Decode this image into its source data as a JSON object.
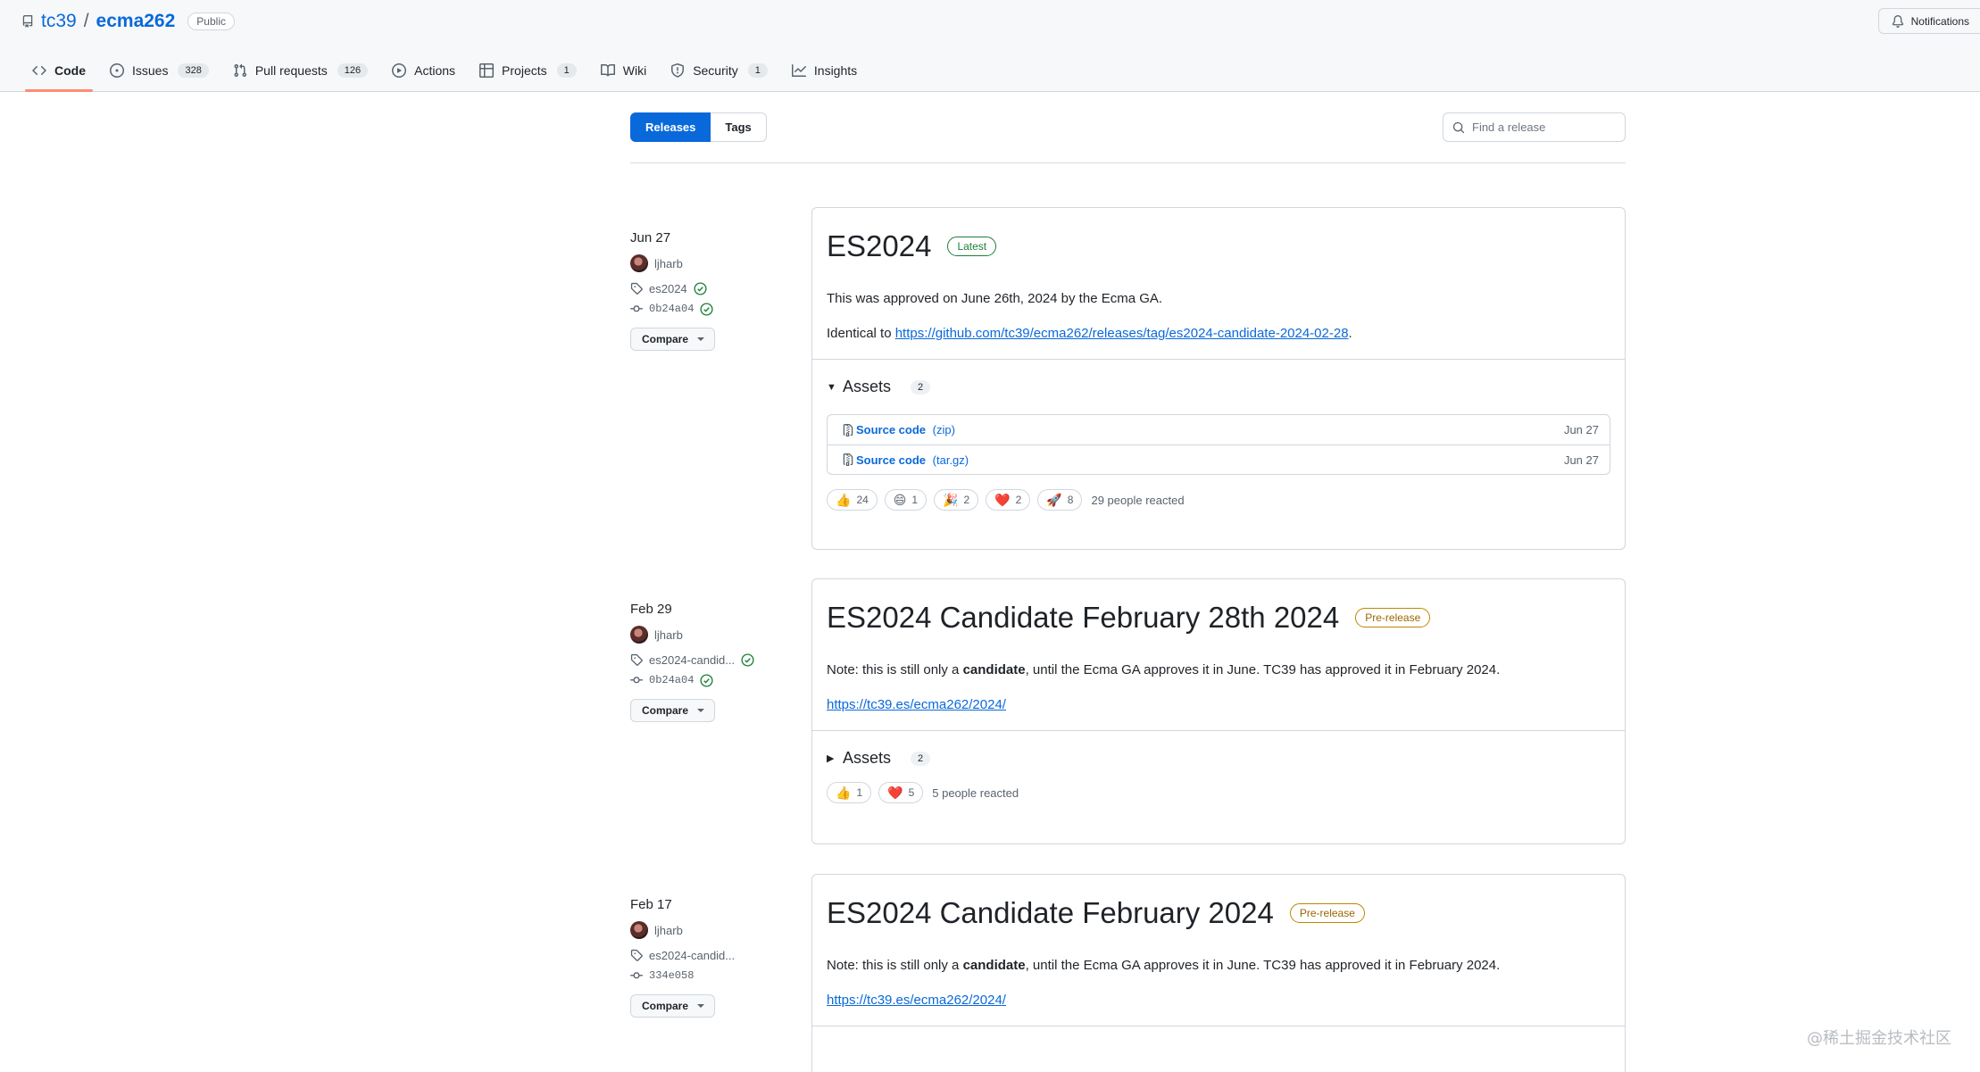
{
  "repo": {
    "owner": "tc39",
    "separator": "/",
    "name": "ecma262",
    "visibility": "Public"
  },
  "notifications_label": "Notifications",
  "nav": [
    {
      "label": "Code",
      "icon": "code-icon",
      "count": ""
    },
    {
      "label": "Issues",
      "icon": "issue-icon",
      "count": "328"
    },
    {
      "label": "Pull requests",
      "icon": "pull-request-icon",
      "count": "126"
    },
    {
      "label": "Actions",
      "icon": "play-icon",
      "count": ""
    },
    {
      "label": "Projects",
      "icon": "table-icon",
      "count": "1"
    },
    {
      "label": "Wiki",
      "icon": "book-icon",
      "count": ""
    },
    {
      "label": "Security",
      "icon": "shield-icon",
      "count": "1"
    },
    {
      "label": "Insights",
      "icon": "graph-icon",
      "count": ""
    }
  ],
  "subnav": {
    "releases": "Releases",
    "tags": "Tags"
  },
  "search": {
    "placeholder": "Find a release"
  },
  "releases": [
    {
      "date": "Jun 27",
      "author": "ljharb",
      "tag": "es2024",
      "commit": "0b24a04",
      "compare": "Compare",
      "title": "ES2024",
      "label": "Latest",
      "p1": "This was approved on June 26th, 2024 by the Ecma GA.",
      "p2_prefix": "Identical to ",
      "p2_link": "https://github.com/tc39/ecma262/releases/tag/es2024-candidate-2024-02-28",
      "p2_suffix": ".",
      "assets_label": "Assets",
      "assets_count": "2",
      "assets": [
        {
          "name": "Source code",
          "ext": "(zip)",
          "date": "Jun 27"
        },
        {
          "name": "Source code",
          "ext": "(tar.gz)",
          "date": "Jun 27"
        }
      ],
      "reactions": [
        {
          "emoji": "👍",
          "count": "24"
        },
        {
          "emoji": "😄",
          "count": "1"
        },
        {
          "emoji": "🎉",
          "count": "2"
        },
        {
          "emoji": "❤️",
          "count": "2"
        },
        {
          "emoji": "🚀",
          "count": "8"
        }
      ],
      "reaction_summary": "29 people reacted"
    },
    {
      "date": "Feb 29",
      "author": "ljharb",
      "tag": "es2024-candid...",
      "commit": "0b24a04",
      "compare": "Compare",
      "title": "ES2024 Candidate February 28th 2024",
      "label": "Pre-release",
      "p1_prefix": "Note: this is still only a ",
      "p1_bold": "candidate",
      "p1_suffix": ", until the Ecma GA approves it in June. TC39 has approved it in February 2024.",
      "p2_link": "https://tc39.es/ecma262/2024/",
      "assets_label": "Assets",
      "assets_count": "2",
      "reactions": [
        {
          "emoji": "👍",
          "count": "1"
        },
        {
          "emoji": "❤️",
          "count": "5"
        }
      ],
      "reaction_summary": "5 people reacted"
    },
    {
      "date": "Feb 17",
      "author": "ljharb",
      "tag": "es2024-candid...",
      "commit": "334e058",
      "compare": "Compare",
      "title": "ES2024 Candidate February 2024",
      "label": "Pre-release",
      "p1_prefix": "Note: this is still only a ",
      "p1_bold": "candidate",
      "p1_suffix": ", until the Ecma GA approves it in June. TC39 has approved it in February 2024.",
      "p2_link": "https://tc39.es/ecma262/2024/"
    }
  ],
  "watermark": "@稀土掘金技术社区"
}
